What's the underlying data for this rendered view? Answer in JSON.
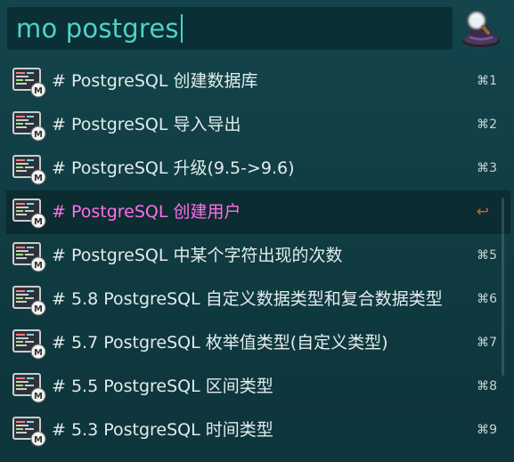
{
  "search": {
    "query": "mo postgres"
  },
  "app": {
    "icon": "alfred-hat-icon"
  },
  "results": [
    {
      "title": "# PostgreSQL 创建数据库",
      "shortcut": "⌘1",
      "selected": false
    },
    {
      "title": "# PostgreSQL 导入导出",
      "shortcut": "⌘2",
      "selected": false
    },
    {
      "title": "# PostgreSQL 升级(9.5->9.6)",
      "shortcut": "⌘3",
      "selected": false
    },
    {
      "title": "# PostgreSQL 创建用户",
      "shortcut": "↩",
      "selected": true
    },
    {
      "title": "# PostgreSQL 中某个字符出现的次数",
      "shortcut": "⌘5",
      "selected": false
    },
    {
      "title": "# 5.8 PostgreSQL 自定义数据类型和复合数据类型",
      "shortcut": "⌘6",
      "selected": false
    },
    {
      "title": "# 5.7 PostgreSQL 枚举值类型(自定义类型)",
      "shortcut": "⌘7",
      "selected": false
    },
    {
      "title": "# 5.5 PostgreSQL 区间类型",
      "shortcut": "⌘8",
      "selected": false
    },
    {
      "title": "# 5.3 PostgreSQL 时间类型",
      "shortcut": "⌘9",
      "selected": false
    }
  ],
  "colors": {
    "query_text": "#4dd3c7",
    "selected_title": "#ff6fe9",
    "enter_glyph": "#e0583a",
    "background": "#103a40"
  }
}
